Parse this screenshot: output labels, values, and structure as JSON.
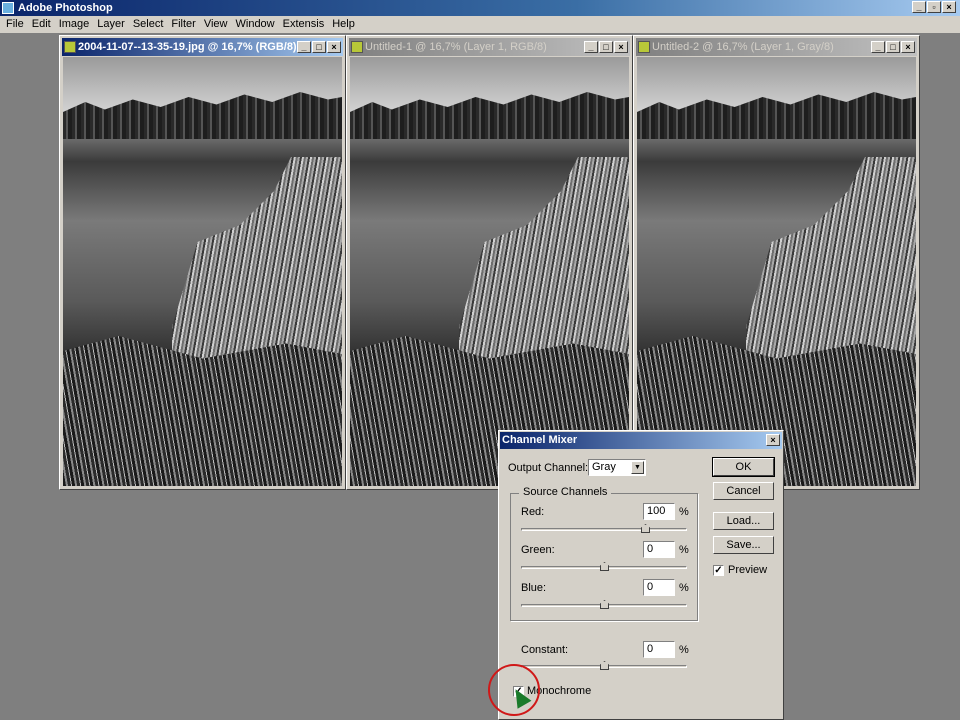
{
  "app": {
    "title": "Adobe Photoshop"
  },
  "menu": [
    "File",
    "Edit",
    "Image",
    "Layer",
    "Select",
    "Filter",
    "View",
    "Window",
    "Extensis",
    "Help"
  ],
  "documents": [
    {
      "title": "2004-11-07--13-35-19.jpg @ 16,7% (RGB/8)",
      "active": true
    },
    {
      "title": "Untitled-1 @ 16,7% (Layer 1, RGB/8)",
      "active": false
    },
    {
      "title": "Untitled-2 @ 16,7% (Layer 1, Gray/8)",
      "active": false
    }
  ],
  "dialog": {
    "title": "Channel Mixer",
    "output_channel_label": "Output Channel:",
    "output_channel": "Gray",
    "source_channels_label": "Source Channels",
    "channels": [
      {
        "label": "Red:",
        "value": "100",
        "pct": 100
      },
      {
        "label": "Green:",
        "value": "0",
        "pct": 0
      },
      {
        "label": "Blue:",
        "value": "0",
        "pct": 0
      }
    ],
    "constant": {
      "label": "Constant:",
      "value": "0",
      "pct": 0
    },
    "percent_sign": "%",
    "slider_range": [
      -200,
      200
    ],
    "buttons": {
      "ok": "OK",
      "cancel": "Cancel",
      "load": "Load...",
      "save": "Save..."
    },
    "preview": {
      "label": "Preview",
      "checked": true
    },
    "monochrome": {
      "label": "Monochrome",
      "checked": true
    }
  }
}
